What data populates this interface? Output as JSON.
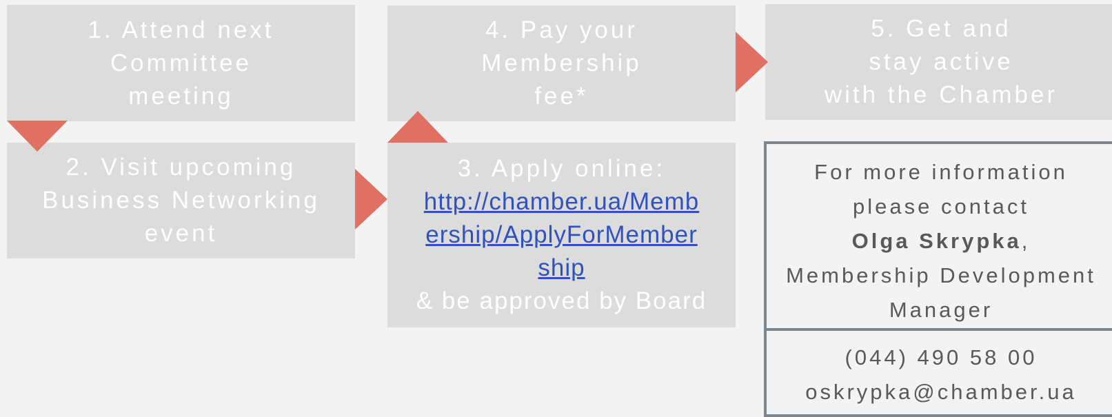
{
  "steps": {
    "step1": {
      "lines": [
        "1.  Attend next",
        "Committee",
        "meeting"
      ]
    },
    "step2": {
      "lines": [
        "2. Visit upcoming",
        "Business Networking",
        "event"
      ]
    },
    "step3": {
      "title": "3. Apply online:",
      "link_lines": [
        "http://chamber.ua/Memb",
        "ership/ApplyForMember",
        "ship"
      ],
      "after": "& be approved by Board"
    },
    "step4": {
      "lines": [
        "4. Pay your",
        "Membership",
        "fee*"
      ]
    },
    "step5": {
      "lines": [
        "5. Get and",
        "stay active",
        "with the Chamber"
      ]
    }
  },
  "contact": {
    "line1": "For more information",
    "line2": "please contact",
    "name": "Olga Skrypka",
    "name_suffix": ",",
    "role_line1": "Membership Development",
    "role_line2": "Manager",
    "phone": "(044) 490 58 00",
    "email": "oskrypka@chamber.ua"
  },
  "colors": {
    "box": "#dcdcdc",
    "arrow": "#e07064",
    "link": "#2f52c0",
    "border": "#7b868e"
  }
}
